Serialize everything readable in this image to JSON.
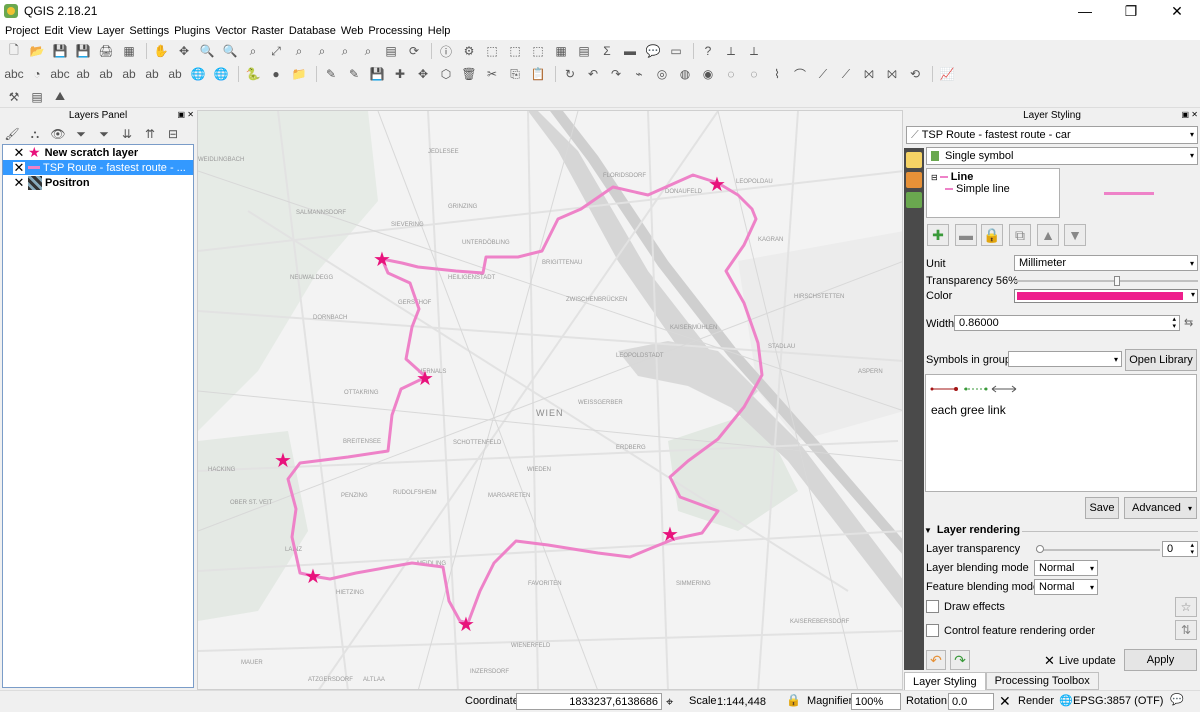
{
  "window": {
    "title": "QGIS 2.18.21",
    "minimize": "—",
    "restore": "❐",
    "close": "✕"
  },
  "menu": [
    "Project",
    "Edit",
    "View",
    "Layer",
    "Settings",
    "Plugins",
    "Vector",
    "Raster",
    "Database",
    "Web",
    "Processing",
    "Help"
  ],
  "layers_panel": {
    "title": "Layers Panel",
    "layers": [
      {
        "name": "New scratch layer",
        "checked": true,
        "selected": false,
        "icon": "star-icon"
      },
      {
        "name": "TSP Route - fastest route - ...",
        "checked": true,
        "selected": true,
        "icon": "line-icon"
      },
      {
        "name": "Positron",
        "checked": true,
        "selected": false,
        "icon": "raster-icon"
      }
    ]
  },
  "map": {
    "route_color": "#ee82c8",
    "star_color": "#e8127c",
    "labels": {
      "wien": "WIEN",
      "floridsdorf": "FLORIDSDORF",
      "leopoldau": "LEOPOLDAU",
      "donaufeld": "DONAUFELD",
      "kagran": "KAGRAN",
      "hirschstetten": "HIRSCHSTETTEN",
      "aspern": "ASPERN",
      "stadlau": "STADLAU",
      "jedlesee": "JEDLESEE",
      "brigittenau": "BRIGITTENAU",
      "zwischenbruecken": "ZWISCHENBRÜCKEN",
      "kaisermuehlen": "KAISERMÜHLEN",
      "leopoldstadt": "LEOPOLDSTADT",
      "weissgerber": "WEISSGERBER",
      "erdberg": "ERDBERG",
      "simmering": "SIMMERING",
      "kaiserebersdorf": "KAISEREBERSDORF",
      "favoriten": "FAVORITEN",
      "meidling": "MEIDLING",
      "margareten": "MARGARETEN",
      "wieden": "WIEDEN",
      "rudolfsheim": "RUDOLFSHEIM",
      "penzing": "PENZING",
      "breitensee": "BREITENSEE",
      "schottenfeld": "SCHOTTENFELD",
      "ottakring": "OTTAKRING",
      "dornbach": "DORNBACH",
      "gersthof": "GERSTHOF",
      "sievering": "SIEVERING",
      "grinzing": "GRINZING",
      "unterdoebling": "UNTERDÖBLING",
      "salmannsdorf": "SALMANNSDORF",
      "hacking": "HACKING",
      "oberstveit": "OBER ST. VEIT",
      "hietzing": "HIETZING",
      "mauer": "MAUER",
      "atzgersdorf": "ATZGERSDORF",
      "altlaa": "ALTLAA",
      "wienerfeld": "WIENERFELD",
      "inzersdorf": "INZERSDORF",
      "heiligenstadt": "HEILIGENSTADT",
      "lainz": "LAINZ",
      "neuwaldegg": "NEUWALDEGG",
      "hernals": "HERNALS",
      "weidlingbach": "WEIDLINGBACH"
    }
  },
  "style_panel": {
    "title": "Layer Styling",
    "layer_combo": "TSP Route - fastest route - car",
    "renderer": "Single symbol",
    "tree": {
      "root": "Line",
      "child": "Simple line"
    },
    "unit_label": "Unit",
    "unit_value": "Millimeter",
    "transparency_label": "Transparency 56%",
    "color_label": "Color",
    "color_value": "#ee1e8c",
    "width_label": "Width",
    "width_value": "0.86000",
    "symbols_group_label": "Symbols in group",
    "open_library": "Open Library",
    "symbol_names": "each  gree  link",
    "save": "Save",
    "advanced": "Advanced",
    "layer_rendering": "Layer rendering",
    "layer_transparency_label": "Layer transparency",
    "layer_transparency_value": "0",
    "layer_blending_label": "Layer blending mode",
    "layer_blending_value": "Normal",
    "feature_blending_label": "Feature blending mode",
    "feature_blending_value": "Normal",
    "draw_effects": "Draw effects",
    "control_order": "Control feature rendering order",
    "live_update": "Live update",
    "apply": "Apply"
  },
  "tabs": [
    "Layer Styling",
    "Processing Toolbox"
  ],
  "status": {
    "coordinate_label": "Coordinate",
    "coordinate_value": "1833237,6138686",
    "scale_label": "Scale",
    "scale_value": "1:144,448",
    "magnifier_label": "Magnifier",
    "magnifier_value": "100%",
    "rotation_label": "Rotation",
    "rotation_value": "0.0",
    "render_label": "Render",
    "crs": "EPSG:3857 (OTF)"
  }
}
